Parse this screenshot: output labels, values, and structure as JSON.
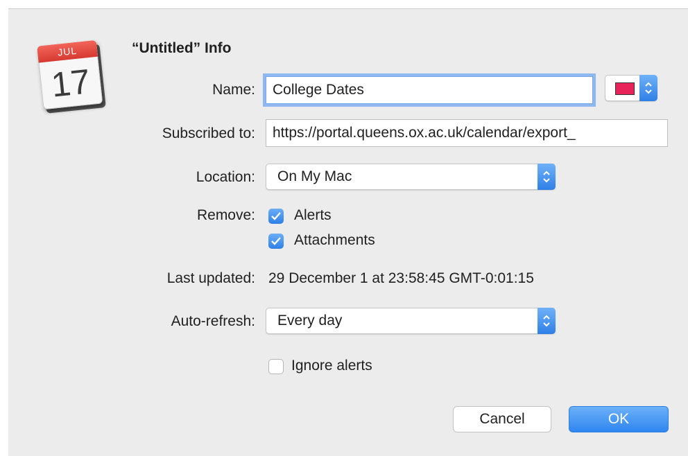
{
  "dialog": {
    "title": "“Untitled” Info",
    "icon": {
      "name": "calendar-app-icon",
      "month": "JUL",
      "day": "17"
    }
  },
  "name": {
    "label": "Name:",
    "value": "College Dates",
    "color_swatch": "#e8235a",
    "color_swatch_icon": "color-popup-icon"
  },
  "subscribed": {
    "label": "Subscribed to:",
    "value": "https://portal.queens.ox.ac.uk/calendar/export_"
  },
  "location": {
    "label": "Location:",
    "value": "On My Mac"
  },
  "remove": {
    "label": "Remove:",
    "options": [
      {
        "label": "Alerts",
        "checked": true
      },
      {
        "label": "Attachments",
        "checked": true
      }
    ]
  },
  "last_updated": {
    "label": "Last updated:",
    "value": "29 December 1 at 23:58:45 GMT-0:01:15"
  },
  "auto_refresh": {
    "label": "Auto-refresh:",
    "value": "Every day"
  },
  "ignore_alerts": {
    "label": "Ignore alerts",
    "checked": false
  },
  "buttons": {
    "cancel": "Cancel",
    "ok": "OK"
  },
  "colors": {
    "accent": "#2f7fe6",
    "background": "#ececec"
  }
}
